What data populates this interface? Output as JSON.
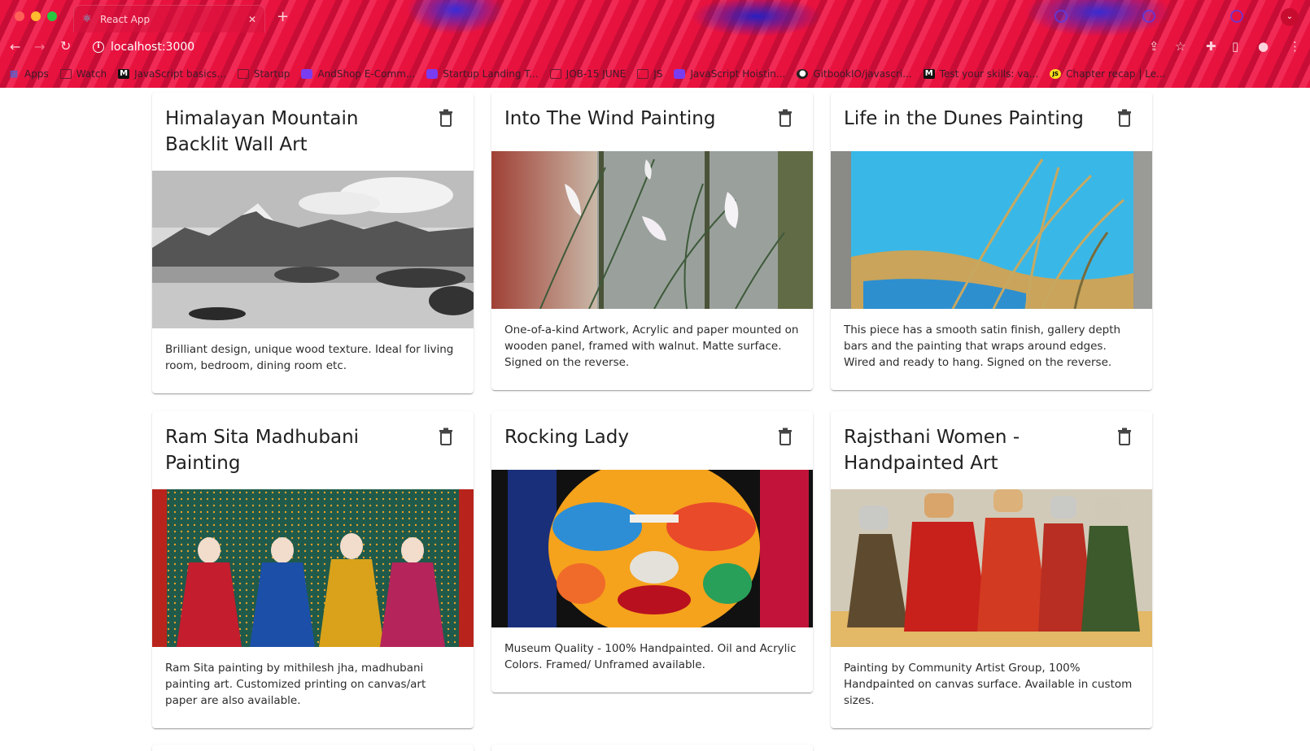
{
  "browser": {
    "tab_title": "React App",
    "tab_close": "✕",
    "new_tab": "+",
    "url": "localhost:3000",
    "menu_label": "⌄"
  },
  "bookmarks": [
    {
      "label": "Apps",
      "icon": "apps-grid-icon"
    },
    {
      "label": "Watch",
      "icon": "folder-icon"
    },
    {
      "label": "JavaScript basics...",
      "icon": "medium-icon"
    },
    {
      "label": "Startup",
      "icon": "folder-icon"
    },
    {
      "label": "AndShop E-Comm...",
      "icon": "site-icon"
    },
    {
      "label": "Startup Landing T...",
      "icon": "site-icon"
    },
    {
      "label": "JOB-15 JUNE",
      "icon": "folder-icon"
    },
    {
      "label": "JS",
      "icon": "folder-icon"
    },
    {
      "label": "JavaScript Hoistin...",
      "icon": "site-icon"
    },
    {
      "label": "GitbookIO/javascri...",
      "icon": "github-icon"
    },
    {
      "label": "Test your skills: va...",
      "icon": "medium-icon"
    },
    {
      "label": "Chapter recap | Le...",
      "icon": "js-icon"
    }
  ],
  "cards": [
    {
      "title": "Himalayan Mountain Backlit Wall Art",
      "description": "Brilliant design, unique wood texture. Ideal for living room, bedroom, dining room etc.",
      "image": "mountain-lake-bw"
    },
    {
      "title": "Into The Wind Painting",
      "description": "One-of-a-kind Artwork, Acrylic and paper mounted on wooden panel, framed with walnut. Matte surface. Signed on the reverse.",
      "image": "white-lilies"
    },
    {
      "title": "Life in the Dunes Painting",
      "description": "This piece has a smooth satin finish, gallery depth bars and the painting that wraps around edges. Wired and ready to hang. Signed on the reverse.",
      "image": "dunes-grass"
    },
    {
      "title": "Ram Sita Madhubani Painting",
      "description": "Ram Sita painting by mithilesh jha, madhubani painting art. Customized printing on canvas/art paper are also available.",
      "image": "madhubani-figures"
    },
    {
      "title": "Rocking Lady",
      "description": "Museum Quality - 100% Handpainted. Oil and Acrylic Colors. Framed/ Unframed available.",
      "image": "colorful-face"
    },
    {
      "title": "Rajsthani Women - Handpainted Art",
      "description": "Painting by Community Artist Group, 100% Handpainted on canvas surface. Available in custom sizes.",
      "image": "rajasthani-women"
    }
  ]
}
